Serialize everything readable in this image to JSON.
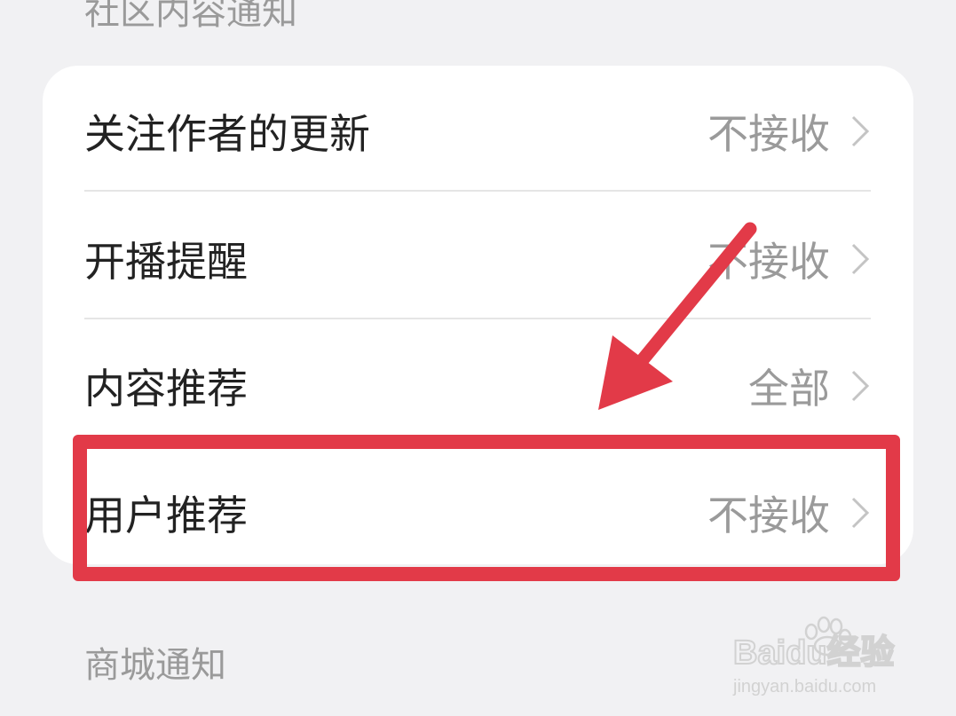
{
  "sections": {
    "community_title": "社区内容通知",
    "mall_title": "商城通知"
  },
  "settings": {
    "rows": [
      {
        "label": "关注作者的更新",
        "value": "不接收",
        "icon": "chevron-right-icon"
      },
      {
        "label": "开播提醒",
        "value": "不接收",
        "icon": "chevron-right-icon"
      },
      {
        "label": "内容推荐",
        "value": "全部",
        "icon": "chevron-right-icon"
      },
      {
        "label": "用户推荐",
        "value": "不接收",
        "icon": "chevron-right-icon"
      }
    ]
  },
  "annotation": {
    "color": "#e23a48",
    "highlighted_row": "用户推荐"
  },
  "watermark": {
    "brand": "Baidu经验",
    "url": "jingyan.baidu.com"
  },
  "colors": {
    "background": "#f1f1f3",
    "card": "#ffffff",
    "label_text": "#222222",
    "secondary_text": "#9a9a9a",
    "divider": "#e5e5e5"
  }
}
